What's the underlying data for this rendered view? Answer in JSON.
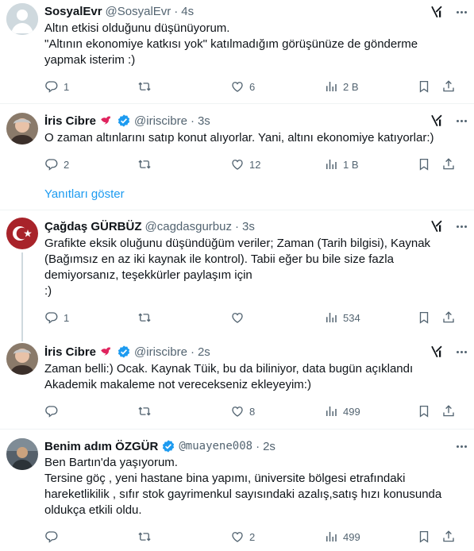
{
  "tweets": [
    {
      "name": "SosyalEvr",
      "handle": "@SosyalEvr",
      "dot": "·",
      "time": "4s",
      "verified": false,
      "lines": [
        "Altın etkisi olduğunu düşünüyorum.",
        "\"Altının ekonomiye katkısı yok\" katılmadığım görüşünüze de gönderme",
        "yapmak isterim :)"
      ],
      "replies": "1",
      "retweets": "",
      "likes": "6",
      "views": "2 B"
    },
    {
      "name": "İris Cibre",
      "handle": "@iriscibre",
      "dot": "·",
      "time": "3s",
      "verified": true,
      "lines": [
        "O zaman altınlarını satıp konut alıyorlar. Yani, altını ekonomiye katıyorlar:)"
      ],
      "replies": "2",
      "retweets": "",
      "likes": "12",
      "views": "1 B"
    },
    {
      "name": "Çağdaş GÜRBÜZ",
      "handle": "@cagdasgurbuz",
      "dot": "·",
      "time": "3s",
      "verified": false,
      "lines": [
        "Grafikte eksik oluğunu düşündüğüm veriler; Zaman (Tarih bilgisi), Kaynak",
        "(Bağımsız en az iki kaynak ile kontrol). Tabii eğer bu bile size fazla",
        "demiyorsanız, teşekkürler paylaşım için",
        ":)"
      ],
      "replies": "1",
      "retweets": "",
      "likes": "",
      "views": "534"
    },
    {
      "name": "İris Cibre",
      "handle": "@iriscibre",
      "dot": "·",
      "time": "2s",
      "verified": true,
      "lines": [
        "Zaman belli:) Ocak. Kaynak Tüik, bu da biliniyor, data bugün açıklandı",
        "Akademik makaleme not verecekseniz ekleyeyim:)"
      ],
      "replies": "",
      "retweets": "",
      "likes": "8",
      "views": "499"
    },
    {
      "name": "Benim adım ÖZGÜR",
      "handle": "@muayene008",
      "dot": "·",
      "time": "2s",
      "verified": true,
      "lines": [
        "Ben Bartın'da yaşıyorum.",
        "Tersine göç , yeni hastane bina yapımı, üniversite bölgesi etrafındaki",
        "hareketlikilik , sıfır stok gayrimenkul sayısındaki azalış,satış hızı konusunda",
        "oldukça etkili oldu."
      ],
      "replies": "",
      "retweets": "",
      "likes": "2",
      "views": "499"
    }
  ],
  "show_replies": "Yanıtları göster",
  "colors": {
    "accent": "#1d9bf0",
    "muted": "#536471",
    "text": "#0f1419"
  }
}
